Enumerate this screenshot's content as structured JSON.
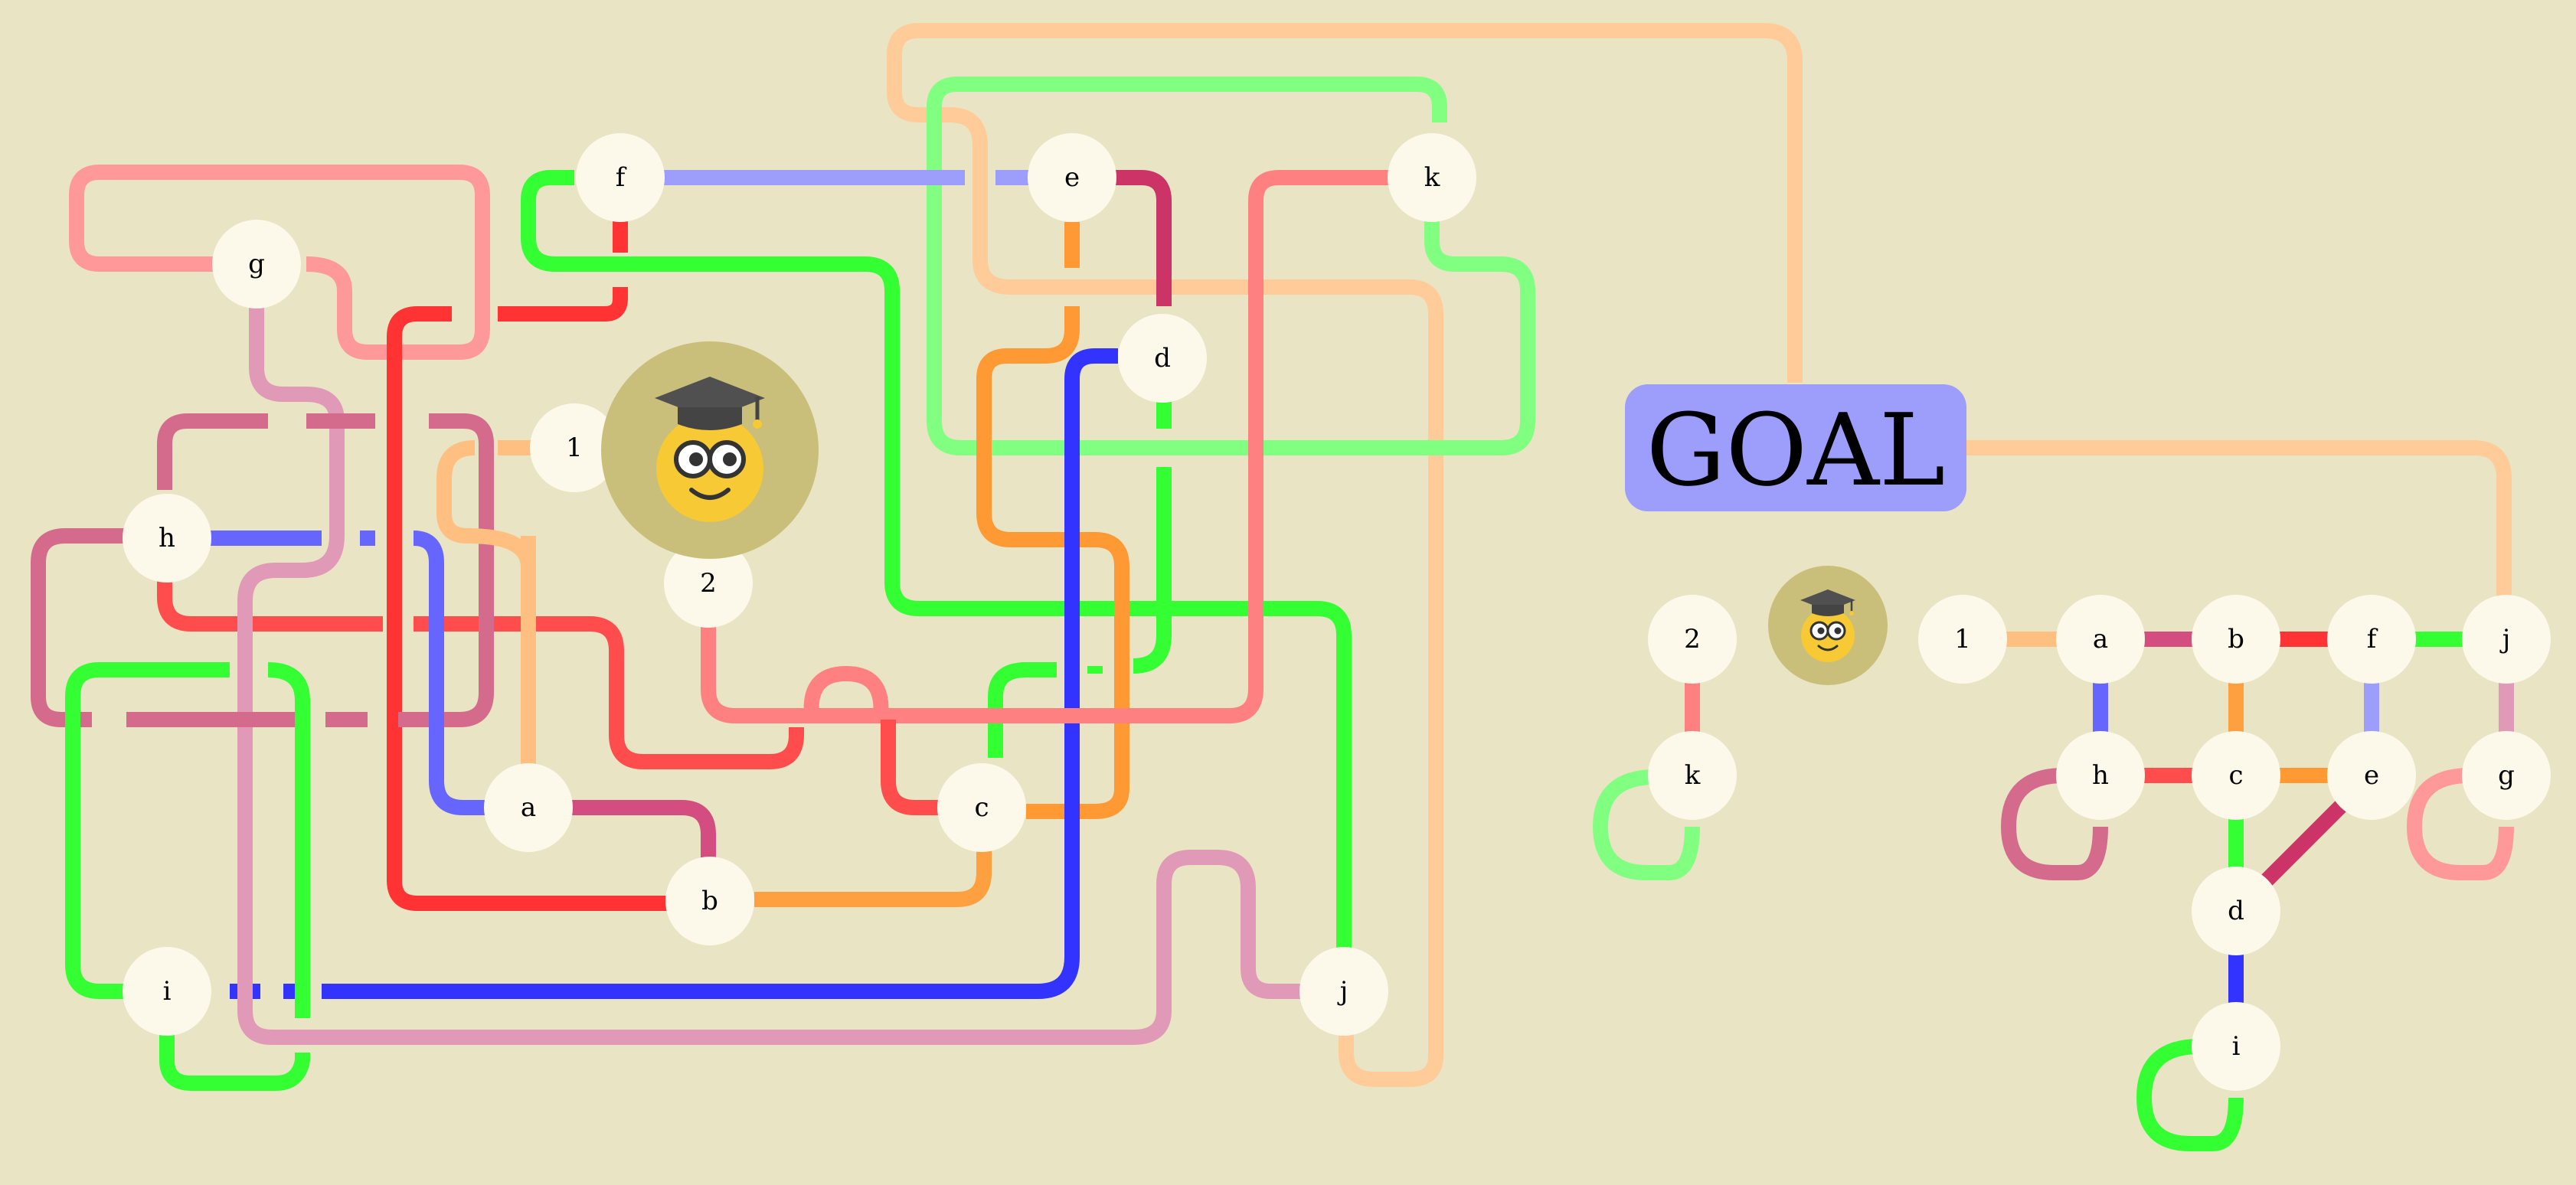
{
  "colors": {
    "background": "#e9e4c4",
    "node_fill": "#fcf9ea",
    "goal_fill": "#9d9dfb",
    "avatar_disc": "#c9bf7a",
    "avatar_face": "#f7c934"
  },
  "goal": {
    "label": "GOAL"
  },
  "maze": {
    "avatar_label": "2",
    "nodes": [
      {
        "id": "f",
        "label": "f"
      },
      {
        "id": "e",
        "label": "e"
      },
      {
        "id": "k",
        "label": "k"
      },
      {
        "id": "g",
        "label": "g"
      },
      {
        "id": "d",
        "label": "d"
      },
      {
        "id": "1",
        "label": "1"
      },
      {
        "id": "2",
        "label": "2"
      },
      {
        "id": "h",
        "label": "h"
      },
      {
        "id": "a",
        "label": "a"
      },
      {
        "id": "c",
        "label": "c"
      },
      {
        "id": "b",
        "label": "b"
      },
      {
        "id": "i",
        "label": "i"
      },
      {
        "id": "j",
        "label": "j"
      }
    ]
  },
  "legend": {
    "nodes": [
      {
        "id": "2",
        "label": "2"
      },
      {
        "id": "k",
        "label": "k"
      },
      {
        "id": "1",
        "label": "1"
      },
      {
        "id": "a",
        "label": "a"
      },
      {
        "id": "b",
        "label": "b"
      },
      {
        "id": "f",
        "label": "f"
      },
      {
        "id": "j",
        "label": "j"
      },
      {
        "id": "h",
        "label": "h"
      },
      {
        "id": "c",
        "label": "c"
      },
      {
        "id": "e",
        "label": "e"
      },
      {
        "id": "g",
        "label": "g"
      },
      {
        "id": "d",
        "label": "d"
      },
      {
        "id": "i",
        "label": "i"
      }
    ],
    "edges": [
      {
        "from": "2",
        "to": "k",
        "color": "#ff8080"
      },
      {
        "from": "k",
        "to": "k",
        "color": "#80ff80"
      },
      {
        "from": "1",
        "to": "a",
        "color": "#ffbf80"
      },
      {
        "from": "a",
        "to": "b",
        "color": "#d44d80"
      },
      {
        "from": "b",
        "to": "f",
        "color": "#ff3333"
      },
      {
        "from": "f",
        "to": "j",
        "color": "#33ff33"
      },
      {
        "from": "a",
        "to": "h",
        "color": "#6666ff"
      },
      {
        "from": "b",
        "to": "c",
        "color": "#ffa040"
      },
      {
        "from": "f",
        "to": "e",
        "color": "#9d9dfb"
      },
      {
        "from": "j",
        "to": "g",
        "color": "#e09ab8"
      },
      {
        "from": "h",
        "to": "c",
        "color": "#ff4d4d"
      },
      {
        "from": "c",
        "to": "e",
        "color": "#ff9933"
      },
      {
        "from": "h",
        "to": "h",
        "color": "#d46a8c"
      },
      {
        "from": "g",
        "to": "g",
        "color": "#ff9999"
      },
      {
        "from": "c",
        "to": "d",
        "color": "#33ff33"
      },
      {
        "from": "e",
        "to": "d",
        "color": "#cc3366"
      },
      {
        "from": "d",
        "to": "i",
        "color": "#3333ff"
      },
      {
        "from": "i",
        "to": "i",
        "color": "#33ff33"
      }
    ]
  }
}
